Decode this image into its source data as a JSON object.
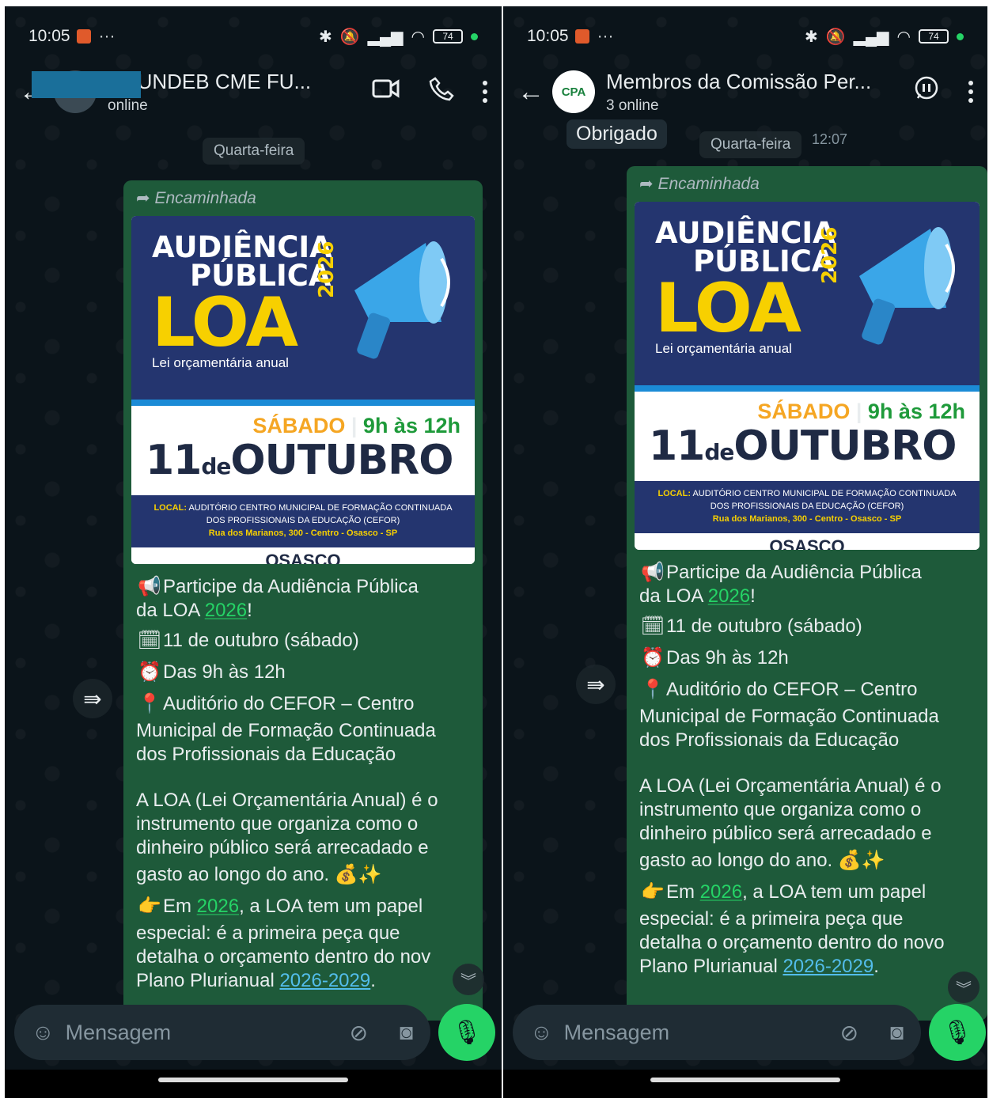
{
  "left": {
    "status": {
      "time": "10:05",
      "dots": "···",
      "battery": "74"
    },
    "header": {
      "title": "FUNDEB CME FU...",
      "subtitle": "online",
      "title_prefix": "n"
    },
    "date_chip": "Quarta-feira",
    "message": {
      "forwarded": "Encaminhada",
      "poster": {
        "line1": "AUDIÊNCIA",
        "line2": "PÚBLICA",
        "loa": "LOA",
        "year": "2026",
        "subtitle": "Lei orçamentária anual",
        "day": "SÁBADO",
        "hours": "9h às 12h",
        "date_num": "11",
        "date_de": "de",
        "month": "OUTUBRO",
        "local_label": "LOCAL:",
        "local_text": "AUDITÓRIO CENTRO MUNICIPAL DE FORMAÇÃO CONTINUADA DOS PROFISSIONAIS DA EDUCAÇÃO (CEFOR)",
        "address": "Rua dos Marianos, 300 - Centro - Osasco - SP",
        "footer": "OSASCO"
      },
      "text": {
        "l1a": "Participe da Audiência Pública",
        "l1b": "da LOA ",
        "l1year": "2026",
        "l1end": "!",
        "l2": "11 de outubro (sábado)",
        "l3": "Das 9h às 12h",
        "l4a": "Auditório do CEFOR – Centro",
        "l4b": "Municipal de Formação Continuada",
        "l4c": "dos Profissionais da Educação",
        "p1": "A LOA (Lei Orçamentária Anual) é o",
        "p2": "instrumento que organiza como o",
        "p3": "dinheiro público será arrecadado e",
        "p4": "gasto ao longo do ano.",
        "e1": "Em ",
        "e1year": "2026",
        "e1end": ", a LOA tem um papel",
        "e2": "especial: é a primeira peça que",
        "e3": "detalha o orçamento dentro do nov",
        "e4": "Plano Plurianual ",
        "e4link": "2026-2029",
        "e4end": "."
      }
    },
    "input": {
      "placeholder": "Mensagem"
    }
  },
  "right": {
    "status": {
      "time": "10:05",
      "dots": "···",
      "battery": "74"
    },
    "header": {
      "title": "Membros da Comissão Per...",
      "subtitle": "3 online",
      "avatar_text": "CPA"
    },
    "prev_message": {
      "text": "Obrigado",
      "time": "12:07"
    },
    "date_chip": "Quarta-feira",
    "message": {
      "forwarded": "Encaminhada",
      "poster": {
        "line1": "AUDIÊNCIA",
        "line2": "PÚBLICA",
        "loa": "LOA",
        "year": "2026",
        "subtitle": "Lei orçamentária anual",
        "day": "SÁBADO",
        "hours": "9h às 12h",
        "date_num": "11",
        "date_de": "de",
        "month": "OUTUBRO",
        "local_label": "LOCAL:",
        "local_text": "AUDITÓRIO CENTRO MUNICIPAL DE FORMAÇÃO CONTINUADA DOS PROFISSIONAIS DA EDUCAÇÃO (CEFOR)",
        "address": "Rua dos Marianos, 300 - Centro - Osasco - SP",
        "footer": "OSASCO"
      },
      "text": {
        "l1a": "Participe da Audiência Pública",
        "l1b": "da LOA ",
        "l1year": "2026",
        "l1end": "!",
        "l2": "11 de outubro (sábado)",
        "l3": "Das 9h às 12h",
        "l4a": "Auditório do CEFOR – Centro",
        "l4b": "Municipal de Formação Continuada",
        "l4c": "dos Profissionais da Educação",
        "p1": "A LOA (Lei Orçamentária Anual) é o",
        "p2": "instrumento que organiza como o",
        "p3": "dinheiro público será arrecadado e",
        "p4": "gasto ao longo do ano.",
        "e1": "Em ",
        "e1year": "2026",
        "e1end": ", a LOA tem um papel",
        "e2": "especial: é a primeira peça que",
        "e3": "detalha o orçamento dentro do novo",
        "e4": "Plano Plurianual ",
        "e4link": "2026-2029",
        "e4end": "."
      }
    },
    "input": {
      "placeholder": "Mensagem"
    }
  },
  "icons": [
    "back-arrow-icon",
    "video-call-icon",
    "phone-icon",
    "more-options-icon",
    "voice-chat-icon",
    "forward-icon",
    "scroll-down-icon",
    "sticker-icon",
    "attach-icon",
    "camera-icon",
    "mic-icon",
    "bluetooth-icon",
    "mute-icon",
    "signal-icon",
    "wifi-icon",
    "battery-icon"
  ],
  "colors": {
    "bubble": "#1e5a3a",
    "accent": "#25d366",
    "link": "#53bdeb",
    "background": "#0b141a"
  }
}
